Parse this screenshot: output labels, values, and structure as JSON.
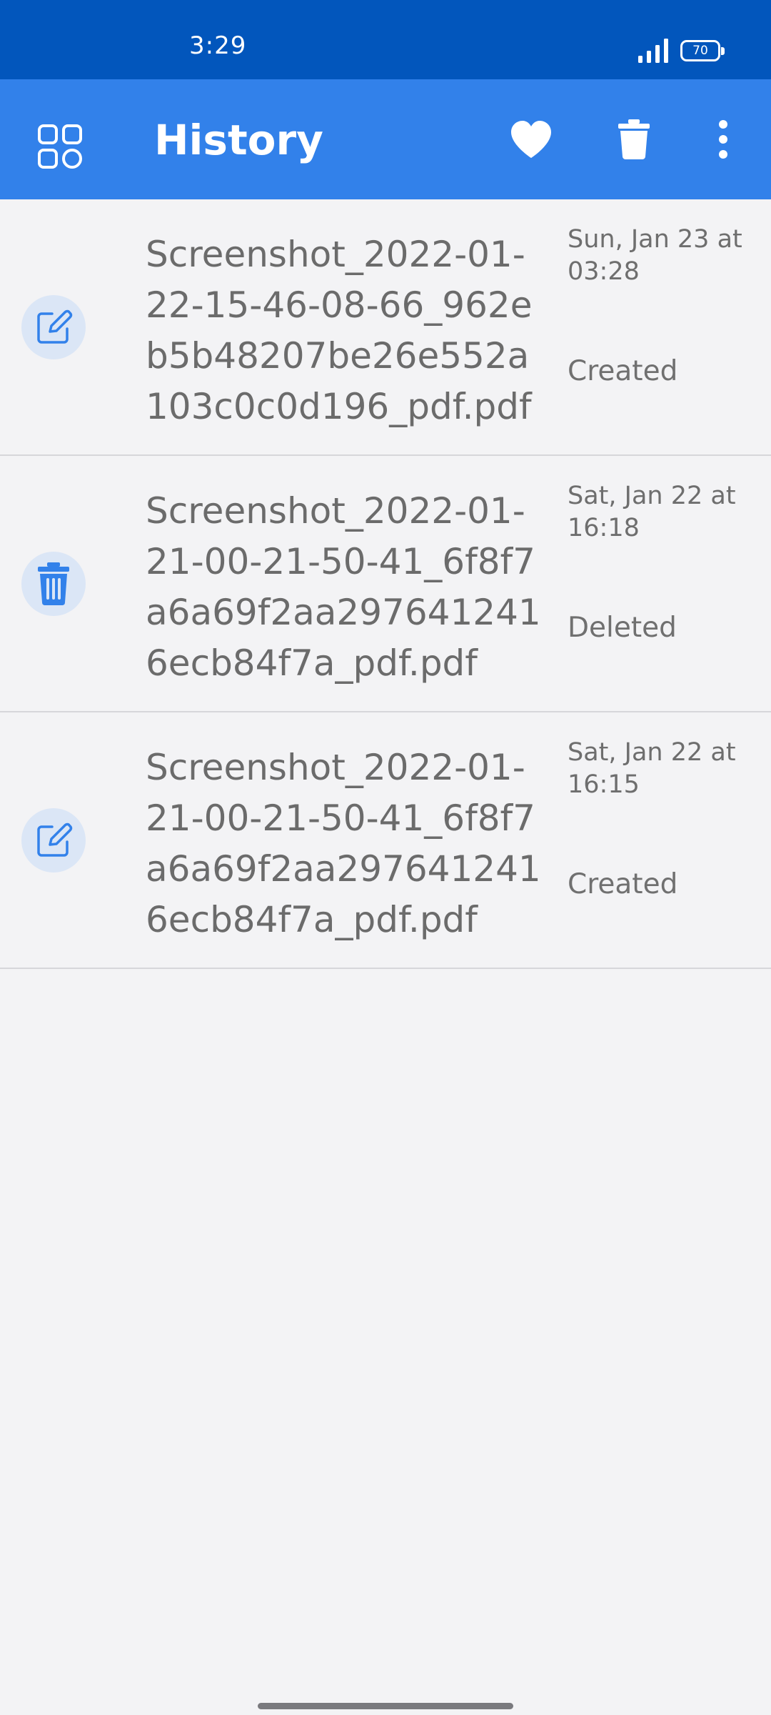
{
  "status_bar": {
    "time": "3:29",
    "battery_level": "70",
    "signal_icon": "signal-bars-icon"
  },
  "app_bar": {
    "title": "History",
    "icons": {
      "menu": "grid-icon",
      "favorite": "heart-icon",
      "delete": "trash-icon",
      "more": "more-vert-icon"
    },
    "background_color": "#3281ea"
  },
  "history": {
    "items": [
      {
        "file_name": "Screenshot_2022-01-22-15-46-08-66_962eb5b48207be26e552a103c0c0d196_pdf.pdf",
        "date": "Sun, Jan 23 at 03:28",
        "action": "Created",
        "icon": "edit-icon"
      },
      {
        "file_name": "Screenshot_2022-01-21-00-21-50-41_6f8f7a6a69f2aa2976412416ecb84f7a_pdf.pdf",
        "date": "Sat, Jan 22 at 16:18",
        "action": "Deleted",
        "icon": "trash-icon"
      },
      {
        "file_name": "Screenshot_2022-01-21-00-21-50-41_6f8f7a6a69f2aa2976412416ecb84f7a_pdf.pdf",
        "date": "Sat, Jan 22 at 16:15",
        "action": "Created",
        "icon": "edit-icon"
      }
    ]
  },
  "colors": {
    "status_bar": "#0256bc",
    "accent": "#3281ea",
    "icon_bg": "#dbe6f6",
    "background": "#f3f3f5"
  }
}
